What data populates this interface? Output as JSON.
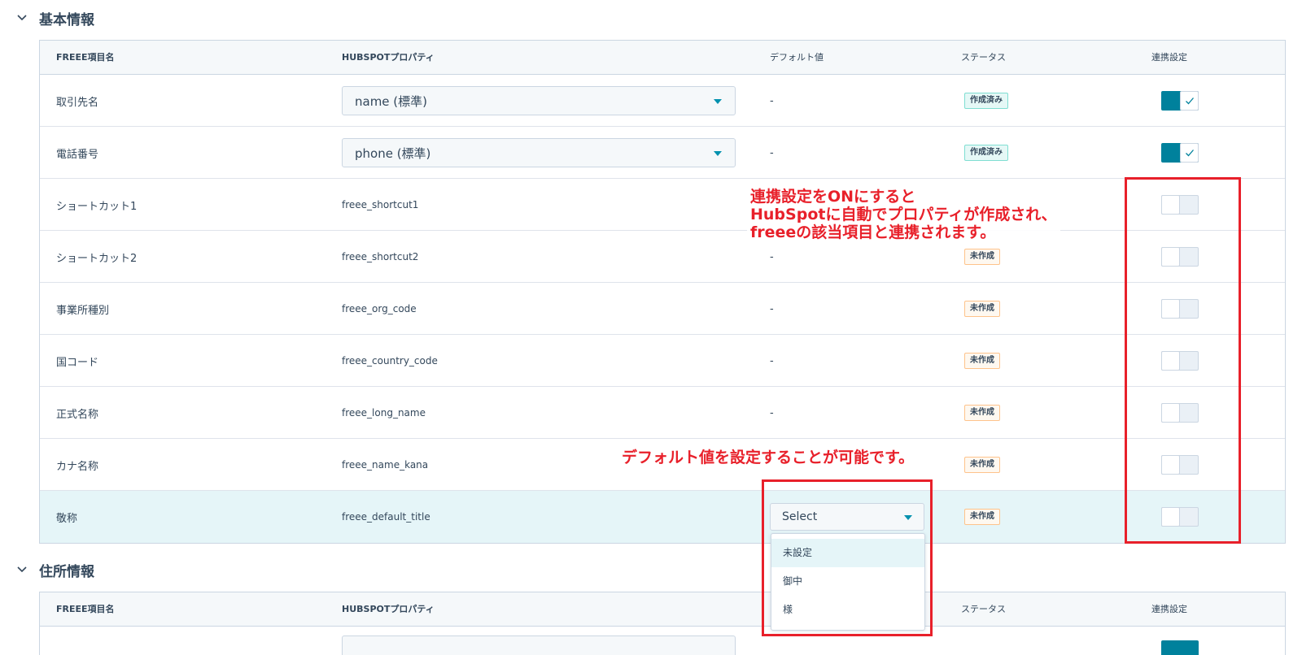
{
  "sections": [
    {
      "title": "基本情報"
    },
    {
      "title": "住所情報"
    }
  ],
  "table_headers": {
    "freee_item": "FREEE項目名",
    "hubspot_property": "HUBSPOTプロパティ",
    "default_value": "デフォルト値",
    "status": "ステータス",
    "sync_setting": "連携設定"
  },
  "rows": [
    {
      "name": "取引先名",
      "property": "name (標準)",
      "property_is_select": true,
      "default": "-",
      "status": "作成済み",
      "status_type": "created",
      "toggle": "on"
    },
    {
      "name": "電話番号",
      "property": "phone (標準)",
      "property_is_select": true,
      "default": "-",
      "status": "作成済み",
      "status_type": "created",
      "toggle": "on"
    },
    {
      "name": "ショートカット1",
      "property": "freee_shortcut1",
      "property_is_select": false,
      "default": "",
      "status": "",
      "status_type": "",
      "toggle": "off"
    },
    {
      "name": "ショートカット2",
      "property": "freee_shortcut2",
      "property_is_select": false,
      "default": "-",
      "status": "未作成",
      "status_type": "pending",
      "toggle": "off"
    },
    {
      "name": "事業所種別",
      "property": "freee_org_code",
      "property_is_select": false,
      "default": "-",
      "status": "未作成",
      "status_type": "pending",
      "toggle": "off"
    },
    {
      "name": "国コード",
      "property": "freee_country_code",
      "property_is_select": false,
      "default": "-",
      "status": "未作成",
      "status_type": "pending",
      "toggle": "off"
    },
    {
      "name": "正式名称",
      "property": "freee_long_name",
      "property_is_select": false,
      "default": "-",
      "status": "未作成",
      "status_type": "pending",
      "toggle": "off"
    },
    {
      "name": "カナ名称",
      "property": "freee_name_kana",
      "property_is_select": false,
      "default": "",
      "status": "未作成",
      "status_type": "pending",
      "toggle": "off"
    },
    {
      "name": "敬称",
      "property": "freee_default_title",
      "property_is_select": false,
      "default": "",
      "default_select": "Select",
      "status": "未作成",
      "status_type": "pending",
      "toggle": "off"
    }
  ],
  "dropdown_options": [
    "未設定",
    "御中",
    "様"
  ],
  "annotations": {
    "toggle_note": [
      "連携設定をONにすると",
      "HubSpotに自動でプロパティが作成され、",
      "freeeの該当項目と連携されます。"
    ],
    "default_note": "デフォルト値を設定することが可能です。"
  },
  "colors": {
    "accent": "#00819c",
    "annotation_red": "#e8202a",
    "header_bg": "#f5f8fa",
    "highlight_row": "#e5f5f8"
  }
}
